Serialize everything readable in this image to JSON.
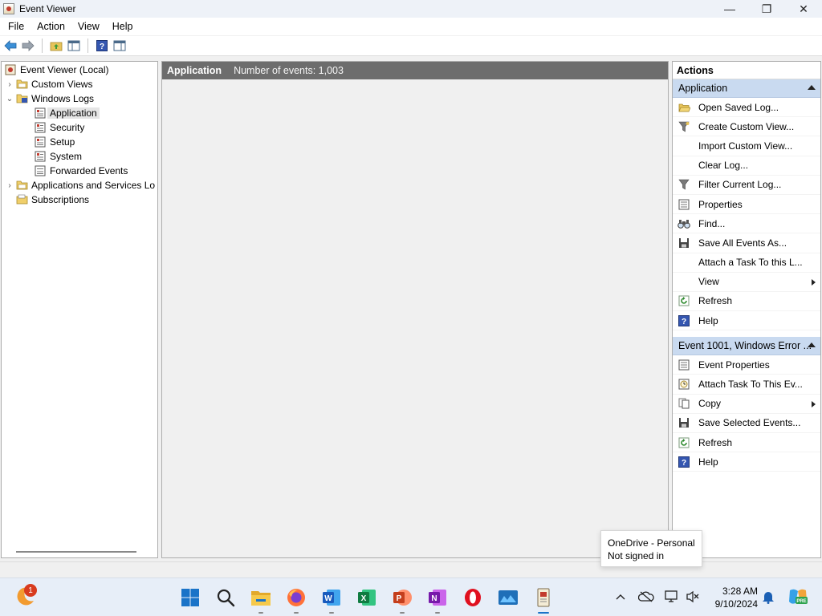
{
  "window": {
    "title": "Event Viewer",
    "minimize_glyph": "—",
    "maximize_glyph": "❐",
    "close_glyph": "✕"
  },
  "menu": [
    "File",
    "Action",
    "View",
    "Help"
  ],
  "toolbar": {
    "icons": [
      "back-arrow-icon",
      "forward-arrow-icon",
      "up-folder-icon",
      "show-hide-tree-icon",
      "help-icon",
      "show-hide-action-pane-icon"
    ]
  },
  "tree": {
    "root": "Event Viewer (Local)",
    "custom_views": "Custom Views",
    "windows_logs": "Windows Logs",
    "logs": [
      "Application",
      "Security",
      "Setup",
      "System",
      "Forwarded Events"
    ],
    "apps_services": "Applications and Services Lo",
    "subscriptions": "Subscriptions",
    "expander_collapsed": "›",
    "expander_expanded": "⌄"
  },
  "center": {
    "log_name": "Application",
    "event_count": "Number of events: 1,003"
  },
  "actions": {
    "title": "Actions",
    "section1": {
      "header": "Application",
      "items": [
        {
          "label": "Open Saved Log...",
          "icon": "folder-icon"
        },
        {
          "label": "Create Custom View...",
          "icon": "filter-icon"
        },
        {
          "label": "Import Custom View...",
          "icon": ""
        },
        {
          "label": "Clear Log...",
          "icon": ""
        },
        {
          "label": "Filter Current Log...",
          "icon": "filter-icon"
        },
        {
          "label": "Properties",
          "icon": "properties-icon"
        },
        {
          "label": "Find...",
          "icon": "find-icon"
        },
        {
          "label": "Save All Events As...",
          "icon": "save-icon"
        },
        {
          "label": "Attach a Task To this L...",
          "icon": ""
        },
        {
          "label": "View",
          "icon": "",
          "submenu": true
        },
        {
          "label": "Refresh",
          "icon": "refresh-icon"
        },
        {
          "label": "Help",
          "icon": "help-icon"
        }
      ]
    },
    "section2": {
      "header": "Event 1001, Windows Error ...",
      "items": [
        {
          "label": "Event Properties",
          "icon": "properties-icon"
        },
        {
          "label": "Attach Task To This Ev...",
          "icon": "task-icon"
        },
        {
          "label": "Copy",
          "icon": "copy-icon",
          "submenu": true
        },
        {
          "label": "Save Selected Events...",
          "icon": "save-icon"
        },
        {
          "label": "Refresh",
          "icon": "refresh-icon"
        },
        {
          "label": "Help",
          "icon": "help-icon"
        }
      ]
    }
  },
  "tooltip": {
    "line1": "OneDrive - Personal",
    "line2": "Not signed in"
  },
  "taskbar": {
    "notification_count": "1",
    "apps": [
      "weather-widget-icon",
      "start-icon",
      "search-icon",
      "file-explorer-icon",
      "firefox-icon",
      "word-icon",
      "excel-icon",
      "powerpoint-icon",
      "onenote-icon",
      "opera-icon",
      "photos-icon",
      "event-viewer-icon"
    ],
    "time": "3:28 AM",
    "date": "9/10/2024"
  },
  "colors": {
    "accent": "#1a73c8",
    "center_header": "#6d6d6d",
    "section_header": "#c9daf0"
  }
}
